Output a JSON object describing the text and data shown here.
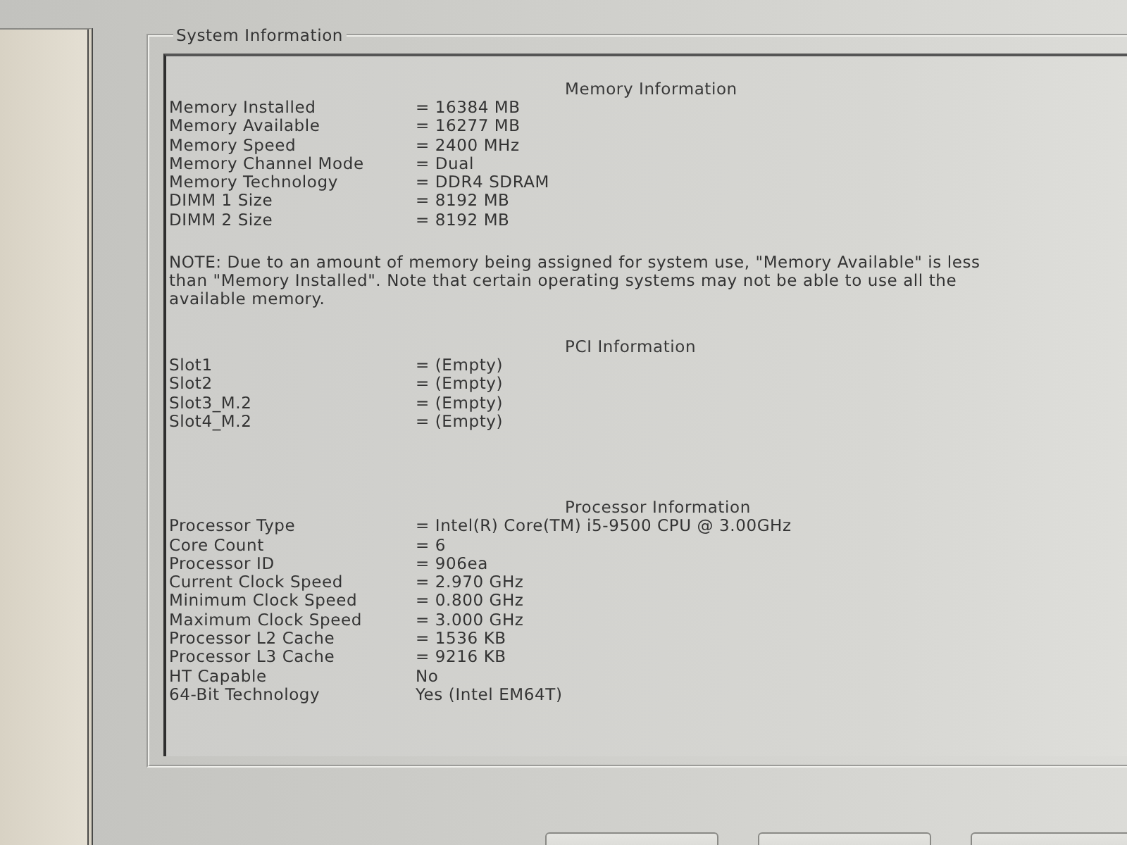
{
  "group_title": "System Information",
  "sections": [
    {
      "title": "Memory Information",
      "rows": [
        {
          "label": "Memory Installed",
          "value": "= 16384 MB"
        },
        {
          "label": "Memory Available",
          "value": "= 16277 MB"
        },
        {
          "label": "Memory Speed",
          "value": "= 2400 MHz"
        },
        {
          "label": "Memory Channel Mode",
          "value": "= Dual"
        },
        {
          "label": "Memory Technology",
          "value": "= DDR4 SDRAM"
        },
        {
          "label": "DIMM 1 Size",
          "value": "= 8192 MB"
        },
        {
          "label": "DIMM 2 Size",
          "value": "= 8192 MB"
        }
      ],
      "note": "NOTE: Due to an amount of memory being assigned for system use, \"Memory Available\" is less than \"Memory Installed\". Note that certain operating systems may not be able to use all the available memory."
    },
    {
      "title": "PCI Information",
      "rows": [
        {
          "label": "Slot1",
          "value": "= (Empty)"
        },
        {
          "label": "Slot2",
          "value": "= (Empty)"
        },
        {
          "label": "Slot3_M.2",
          "value": "= (Empty)"
        },
        {
          "label": "Slot4_M.2",
          "value": "= (Empty)"
        }
      ]
    },
    {
      "title": "Processor Information",
      "rows": [
        {
          "label": "Processor Type",
          "value": "= Intel(R) Core(TM) i5-9500 CPU @ 3.00GHz"
        },
        {
          "label": "Core Count",
          "value": "= 6"
        },
        {
          "label": "Processor ID",
          "value": "= 906ea"
        },
        {
          "label": "Current Clock Speed",
          "value": "= 2.970 GHz"
        },
        {
          "label": "Minimum Clock Speed",
          "value": "= 0.800 GHz"
        },
        {
          "label": "Maximum Clock Speed",
          "value": "= 3.000 GHz"
        },
        {
          "label": "Processor L2 Cache",
          "value": "= 1536 KB"
        },
        {
          "label": "Processor L3 Cache",
          "value": "= 9216 KB"
        },
        {
          "label": "HT Capable",
          "value": "No"
        },
        {
          "label": "64-Bit Technology",
          "value": "Yes (Intel EM64T)"
        }
      ]
    }
  ]
}
